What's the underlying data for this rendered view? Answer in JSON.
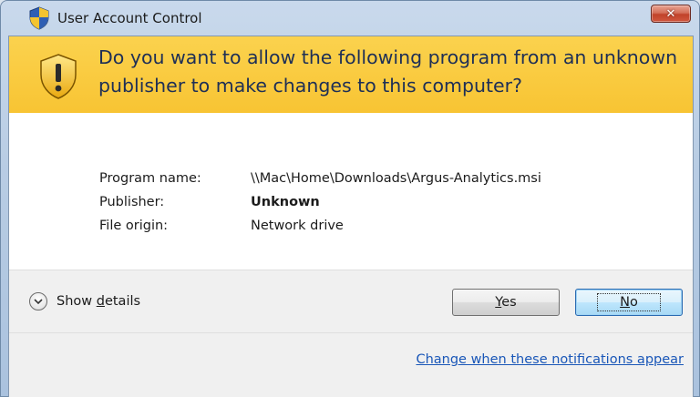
{
  "window": {
    "title": "User Account Control",
    "close_label": "✕"
  },
  "banner": {
    "question": "Do you want to allow the following program from an unknown publisher to make changes to this computer?"
  },
  "details": {
    "program_name_label": "Program name:",
    "program_name_value": "\\\\Mac\\Home\\Downloads\\Argus-Analytics.msi",
    "publisher_label": "Publisher:",
    "publisher_value": "Unknown",
    "file_origin_label": "File origin:",
    "file_origin_value": "Network drive"
  },
  "actions": {
    "show_details_label_pre": "Show ",
    "show_details_label_accel": "d",
    "show_details_label_post": "etails",
    "yes_accel": "Y",
    "yes_rest": "es",
    "no_accel": "N",
    "no_rest": "o"
  },
  "footer": {
    "link_text": "Change when these notifications appear"
  },
  "colors": {
    "banner": "#f8c433",
    "link": "#1a57b8"
  }
}
